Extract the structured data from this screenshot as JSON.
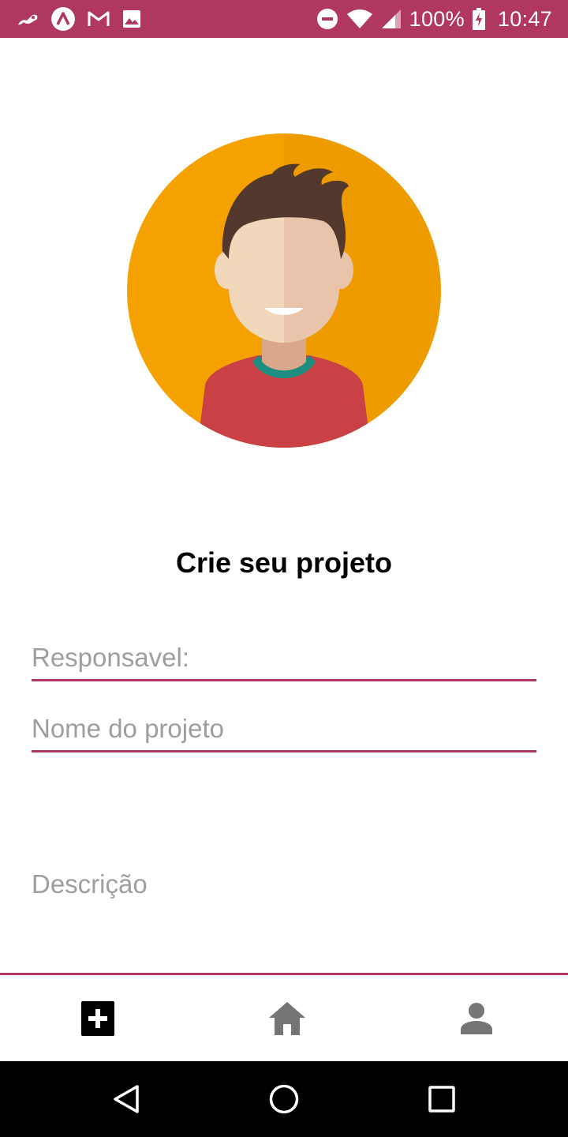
{
  "status_bar": {
    "battery": "100%",
    "time": "10:47",
    "background_color": "#b03760",
    "left_icons": [
      "link-icon",
      "app-logo-icon",
      "gmail-icon",
      "image-icon"
    ],
    "right_icons": [
      "do-not-disturb-icon",
      "wifi-icon",
      "signal-icon",
      "battery-charging-icon"
    ]
  },
  "avatar": {
    "icon": "avatar-illustration",
    "colors": {
      "background": "#f5a100",
      "shirt": "#c94045",
      "hair": "#53382d",
      "skin": "#f2d8bb"
    }
  },
  "form": {
    "title": "Crie seu projeto",
    "responsavel": {
      "placeholder": "Responsavel:",
      "value": ""
    },
    "nome_projeto": {
      "placeholder": "Nome do projeto",
      "value": ""
    },
    "descricao": {
      "placeholder": "Descrição",
      "value": ""
    },
    "accent_color": "#b03760"
  },
  "tab_bar": {
    "items": [
      {
        "icon": "add-box-icon",
        "active": true
      },
      {
        "icon": "home-icon",
        "active": false
      },
      {
        "icon": "person-icon",
        "active": false
      }
    ]
  },
  "nav_bar": {
    "items": [
      "back-icon",
      "home-circle-icon",
      "recents-icon"
    ]
  }
}
